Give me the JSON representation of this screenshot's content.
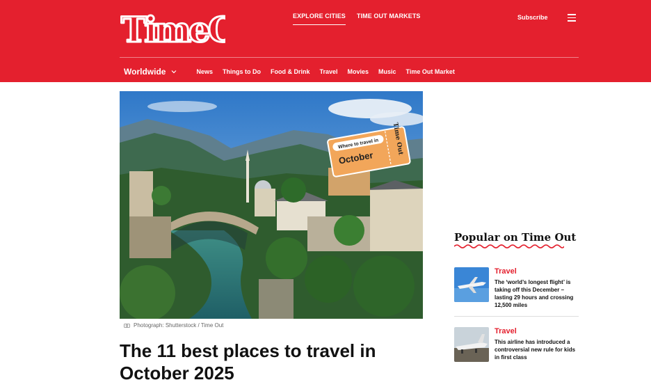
{
  "header": {
    "logo_text": "Time Out",
    "nav": [
      {
        "label": "EXPLORE CITIES",
        "active": true
      },
      {
        "label": "TIME OUT MARKETS",
        "active": false
      }
    ],
    "subscribe_label": "Subscribe",
    "menu_icon": "hamburger-menu-icon",
    "edition_label": "Worldwide",
    "sections": [
      "News",
      "Things to Do",
      "Food & Drink",
      "Travel",
      "Movies",
      "Music",
      "Time Out Market"
    ]
  },
  "hero": {
    "badge_label": "Where to travel in",
    "badge_month": "October",
    "caption": "Photograph: Shutterstock / Time Out",
    "image_description": "Mostar old bridge over river with mountains"
  },
  "article": {
    "headline": "The 11 best places to travel in October 2025"
  },
  "popular": {
    "title": "Popular on Time Out",
    "items": [
      {
        "category": "Travel",
        "title": "The ‘world’s longest flight’ is taking off this December – lasting 29 hours and crossing 12,500 miles"
      },
      {
        "category": "Travel",
        "title": "This airline has introduced a controversial new rule for kids in first class"
      }
    ]
  },
  "colors": {
    "brand_red": "#e4202e",
    "text": "#111111"
  }
}
